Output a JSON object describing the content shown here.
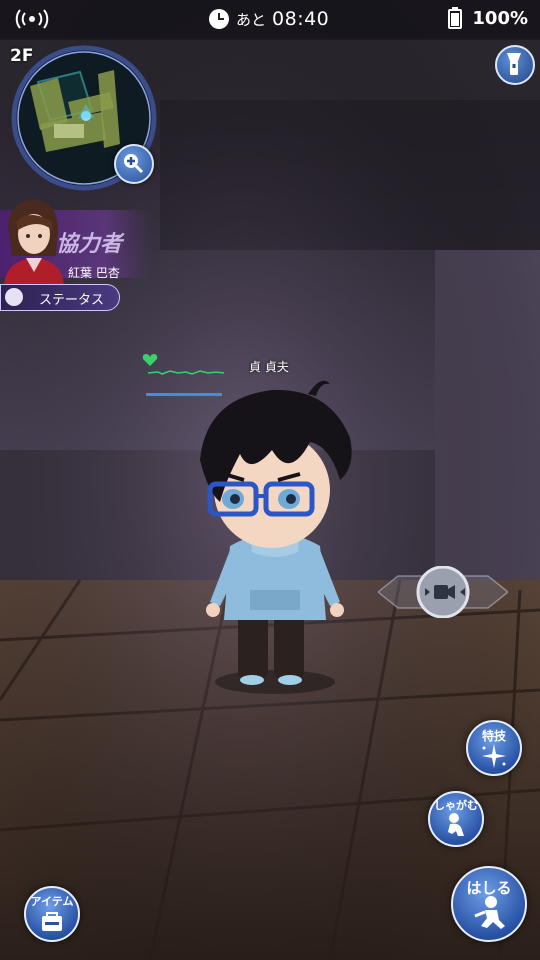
{
  "status_bar": {
    "time_prefix": "あと",
    "time": "08:40",
    "battery_percent": "100%"
  },
  "minimap": {
    "floor": "2F"
  },
  "partner": {
    "title": "協力者",
    "name": "紅葉 巴杏",
    "status_label": "ステータス"
  },
  "player": {
    "name": "貞 貞夫",
    "hp_fraction": 1.0
  },
  "actions": {
    "skill_label": "特技",
    "crouch_label": "しゃがむ",
    "run_label": "はしる",
    "item_label": "アイテム"
  },
  "colors": {
    "button_blue": "#2952a5",
    "hp_blue": "#3a8fe8",
    "hp_green": "#3bd16a",
    "partner_purple": "#6a2fa0"
  }
}
